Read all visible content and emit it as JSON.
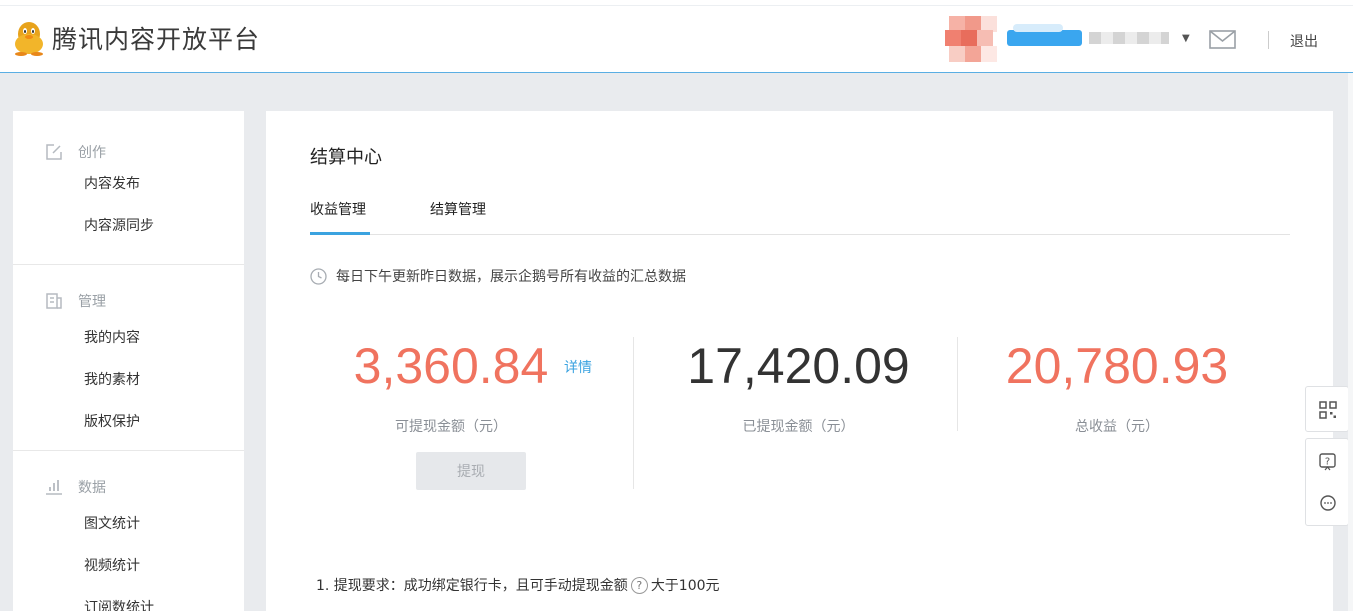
{
  "header": {
    "logo_text": "腾讯内容开放平台",
    "logout_label": "退出"
  },
  "sidebar": {
    "groups": [
      {
        "label": "创作",
        "icon": "edit-icon",
        "items": [
          "内容发布",
          "内容源同步"
        ]
      },
      {
        "label": "管理",
        "icon": "document-icon",
        "items": [
          "我的内容",
          "我的素材",
          "版权保护"
        ]
      },
      {
        "label": "数据",
        "icon": "bar-chart-icon",
        "items": [
          "图文统计",
          "视频统计",
          "订阅数统计"
        ]
      }
    ]
  },
  "main": {
    "title": "结算中心",
    "tabs": [
      {
        "label": "收益管理",
        "active": true
      },
      {
        "label": "结算管理",
        "active": false
      }
    ],
    "notice": "每日下午更新昨日数据，展示企鹅号所有收益的汇总数据",
    "stats": {
      "withdrawable": {
        "value": "3,360.84",
        "label": "可提现金额（元）",
        "detail_link": "详情",
        "color": "#f0735f"
      },
      "withdrawn": {
        "value": "17,420.09",
        "label": "已提现金额（元）",
        "color": "#333333"
      },
      "total": {
        "value": "20,780.93",
        "label": "总收益（元）",
        "color": "#f0735f"
      }
    },
    "withdraw_button": "提现",
    "requirement_prefix": "1.  提现要求：成功绑定银行卡，且可手动提现金额",
    "requirement_suffix": "大于100元"
  },
  "colors": {
    "accent": "#3ba3e0",
    "highlight": "#f0735f"
  }
}
